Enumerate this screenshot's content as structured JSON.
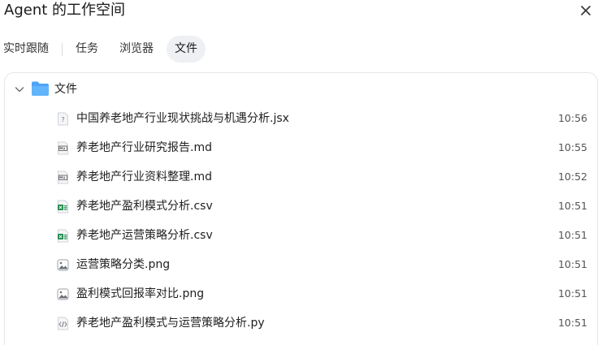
{
  "window": {
    "title": "Agent 的工作空间",
    "close_icon": "close-icon"
  },
  "tabs": [
    {
      "label": "实时跟随",
      "active": false
    },
    {
      "label": "任务",
      "active": false
    },
    {
      "label": "浏览器",
      "active": false
    },
    {
      "label": "文件",
      "active": true
    }
  ],
  "folder": {
    "label": "文件",
    "expanded": true,
    "icon": "folder-icon",
    "icon_color": "#4fa3f7"
  },
  "files": [
    {
      "name": "中国养老地产行业现状挑战与机遇分析.jsx",
      "time": "10:56",
      "icon": "unknown-file-icon"
    },
    {
      "name": "养老地产行业研究报告.md",
      "time": "10:55",
      "icon": "markdown-file-icon"
    },
    {
      "name": "养老地产行业资料整理.md",
      "time": "10:52",
      "icon": "markdown-file-icon"
    },
    {
      "name": "养老地产盈利模式分析.csv",
      "time": "10:51",
      "icon": "spreadsheet-file-icon"
    },
    {
      "name": "养老地产运营策略分析.csv",
      "time": "10:51",
      "icon": "spreadsheet-file-icon"
    },
    {
      "name": "运营策略分类.png",
      "time": "10:51",
      "icon": "image-file-icon"
    },
    {
      "name": "盈利模式回报率对比.png",
      "time": "10:51",
      "icon": "image-file-icon"
    },
    {
      "name": "养老地产盈利模式与运营策略分析.py",
      "time": "10:51",
      "icon": "code-file-icon"
    }
  ],
  "colors": {
    "active_tab_bg": "#eef0f3",
    "folder_blue": "#4fa3f7",
    "spreadsheet_green": "#1f8a4c",
    "border": "#e6e6e6"
  }
}
